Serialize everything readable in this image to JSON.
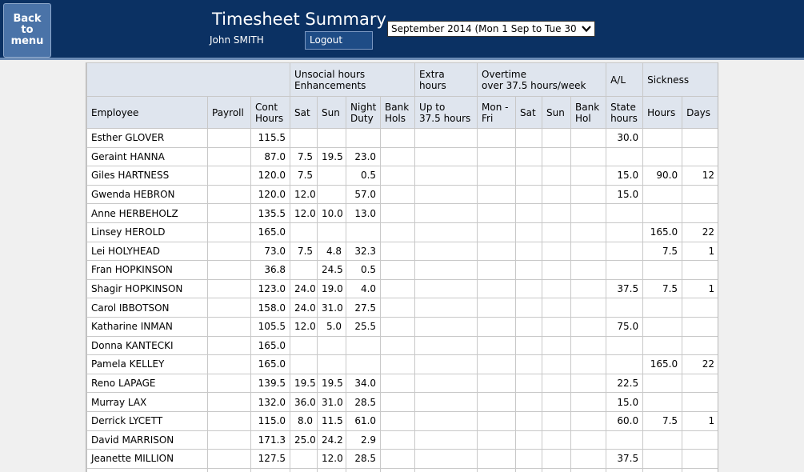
{
  "header": {
    "back_label": "Back\nto\nmenu",
    "title": "Timesheet Summary",
    "user": "John SMITH",
    "logout_label": "Logout",
    "period_selected": "September 2014 (Mon 1 Sep to Tue 30 Sep)"
  },
  "table": {
    "groups": [
      {
        "label": "",
        "span": 3
      },
      {
        "label": "Unsocial hours\nEnhancements",
        "span": 4
      },
      {
        "label": "Extra\nhours",
        "span": 1
      },
      {
        "label": "Overtime\nover 37.5 hours/week",
        "span": 4
      },
      {
        "label": "A/L",
        "span": 1
      },
      {
        "label": "Sickness",
        "span": 2
      }
    ],
    "columns": [
      "Employee",
      "Payroll",
      "Cont\nHours",
      "Sat",
      "Sun",
      "Night\nDuty",
      "Bank\nHols",
      "Up to\n37.5 hours",
      "Mon -\nFri",
      "Sat",
      "Sun",
      "Bank\nHol",
      "State\nhours",
      "Hours",
      "Days"
    ],
    "rows": [
      [
        "Esther GLOVER",
        "",
        "115.5",
        "",
        "",
        "",
        "",
        "",
        "",
        "",
        "",
        "",
        "30.0",
        "",
        ""
      ],
      [
        "Geraint HANNA",
        "",
        "87.0",
        "7.5",
        "19.5",
        "23.0",
        "",
        "",
        "",
        "",
        "",
        "",
        "",
        "",
        ""
      ],
      [
        "Giles HARTNESS",
        "",
        "120.0",
        "7.5",
        "",
        "0.5",
        "",
        "",
        "",
        "",
        "",
        "",
        "15.0",
        "90.0",
        "12"
      ],
      [
        "Gwenda HEBRON",
        "",
        "120.0",
        "12.0",
        "",
        "57.0",
        "",
        "",
        "",
        "",
        "",
        "",
        "15.0",
        "",
        ""
      ],
      [
        "Anne HERBEHOLZ",
        "",
        "135.5",
        "12.0",
        "10.0",
        "13.0",
        "",
        "",
        "",
        "",
        "",
        "",
        "",
        "",
        ""
      ],
      [
        "Linsey HEROLD",
        "",
        "165.0",
        "",
        "",
        "",
        "",
        "",
        "",
        "",
        "",
        "",
        "",
        "165.0",
        "22"
      ],
      [
        "Lei HOLYHEAD",
        "",
        "73.0",
        "7.5",
        "4.8",
        "32.3",
        "",
        "",
        "",
        "",
        "",
        "",
        "",
        "7.5",
        "1"
      ],
      [
        "Fran HOPKINSON",
        "",
        "36.8",
        "",
        "24.5",
        "0.5",
        "",
        "",
        "",
        "",
        "",
        "",
        "",
        "",
        ""
      ],
      [
        "Shagir HOPKINSON",
        "",
        "123.0",
        "24.0",
        "19.0",
        "4.0",
        "",
        "",
        "",
        "",
        "",
        "",
        "37.5",
        "7.5",
        "1"
      ],
      [
        "Carol IBBOTSON",
        "",
        "158.0",
        "24.0",
        "31.0",
        "27.5",
        "",
        "",
        "",
        "",
        "",
        "",
        "",
        "",
        ""
      ],
      [
        "Katharine INMAN",
        "",
        "105.5",
        "12.0",
        "5.0",
        "25.5",
        "",
        "",
        "",
        "",
        "",
        "",
        "75.0",
        "",
        ""
      ],
      [
        "Donna KANTECKI",
        "",
        "165.0",
        "",
        "",
        "",
        "",
        "",
        "",
        "",
        "",
        "",
        "",
        "",
        ""
      ],
      [
        "Pamela KELLEY",
        "",
        "165.0",
        "",
        "",
        "",
        "",
        "",
        "",
        "",
        "",
        "",
        "",
        "165.0",
        "22"
      ],
      [
        "Reno LAPAGE",
        "",
        "139.5",
        "19.5",
        "19.5",
        "34.0",
        "",
        "",
        "",
        "",
        "",
        "",
        "22.5",
        "",
        ""
      ],
      [
        "Murray LAX",
        "",
        "132.0",
        "36.0",
        "31.0",
        "28.5",
        "",
        "",
        "",
        "",
        "",
        "",
        "15.0",
        "",
        ""
      ],
      [
        "Derrick LYCETT",
        "",
        "115.0",
        "8.0",
        "11.5",
        "61.0",
        "",
        "",
        "",
        "",
        "",
        "",
        "60.0",
        "7.5",
        "1"
      ],
      [
        "David MARRISON",
        "",
        "171.3",
        "25.0",
        "24.2",
        "2.9",
        "",
        "",
        "",
        "",
        "",
        "",
        "",
        "",
        ""
      ],
      [
        "Jeanette MILLION",
        "",
        "127.5",
        "",
        "12.0",
        "28.5",
        "",
        "",
        "",
        "",
        "",
        "",
        "37.5",
        "",
        ""
      ],
      [
        "",
        "",
        "",
        "",
        "",
        "",
        "",
        "",
        "",
        "",
        "",
        "",
        "",
        "",
        ""
      ]
    ]
  }
}
